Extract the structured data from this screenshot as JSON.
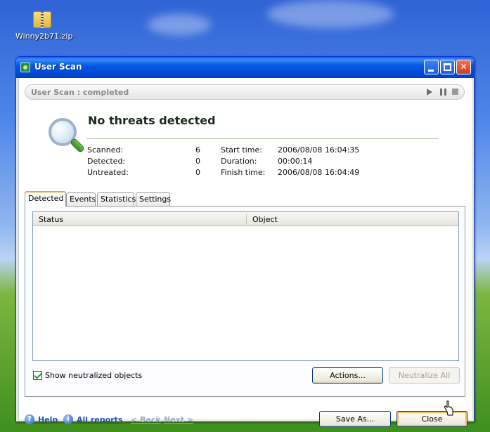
{
  "desktop": {
    "icon_label": "Winny2b71.zip"
  },
  "window": {
    "title": "User Scan",
    "buttons": {
      "minimize": "",
      "maximize": "",
      "close": "✕"
    }
  },
  "status": {
    "text": "User Scan : completed"
  },
  "result": {
    "headline": "No threats detected",
    "left_stats": [
      {
        "label": "Scanned:",
        "value": "6"
      },
      {
        "label": "Detected:",
        "value": "0"
      },
      {
        "label": "Untreated:",
        "value": "0"
      }
    ],
    "right_stats": [
      {
        "label": "Start time:",
        "value": "2006/08/08 16:04:35"
      },
      {
        "label": "Duration:",
        "value": "00:00:14"
      },
      {
        "label": "Finish time:",
        "value": "2006/08/08 16:04:49"
      }
    ]
  },
  "tabs": [
    "Detected",
    "Events",
    "Statistics",
    "Settings"
  ],
  "list": {
    "columns": [
      "Status",
      "Object"
    ]
  },
  "options": {
    "show_neutralized_label": "Show neutralized objects",
    "show_neutralized_checked": true
  },
  "buttons": {
    "actions": "Actions...",
    "neutralize_all": "Neutralize All",
    "save_as": "Save As...",
    "close": "Close"
  },
  "footer": {
    "help": "Help",
    "all_reports": "All reports",
    "back": "< Back",
    "next": "Next >"
  },
  "colors": {
    "title_bar": "#0058e6",
    "headline": "#1a2a1a",
    "link": "#2650b8"
  }
}
